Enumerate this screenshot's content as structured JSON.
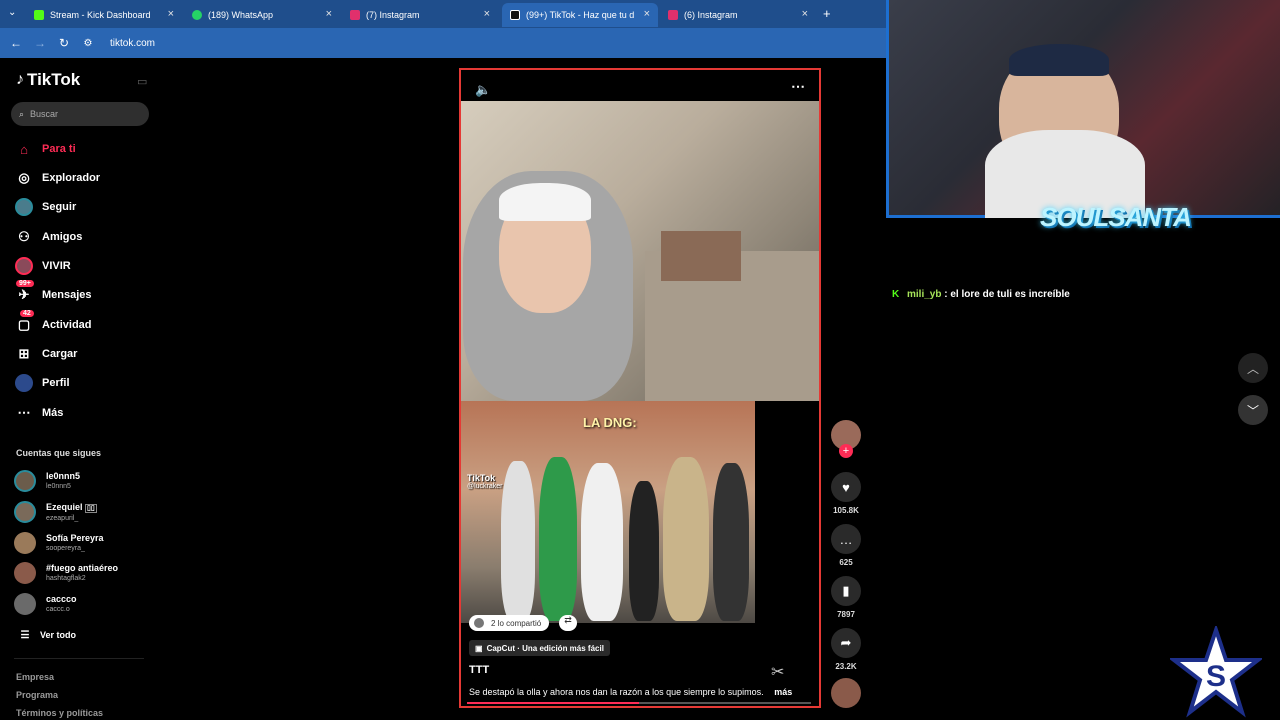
{
  "browser": {
    "tabs": [
      {
        "title": "Stream - Kick Dashboard",
        "icon": "kick-icon",
        "color": "#53fc18"
      },
      {
        "title": "(189) WhatsApp",
        "icon": "whatsapp-icon",
        "color": "#25d366"
      },
      {
        "title": "(7) Instagram",
        "icon": "instagram-icon",
        "color": "#e1306c"
      },
      {
        "title": "(99+) TikTok - Haz que tu d",
        "icon": "tiktok-icon",
        "color": "#000000",
        "active": true
      },
      {
        "title": "(6) Instagram",
        "icon": "instagram-icon",
        "color": "#e1306c"
      }
    ],
    "url": "tiktok.com"
  },
  "sidebar": {
    "logo": "TikTok",
    "search_placeholder": "Buscar",
    "nav": [
      {
        "label": "Para ti",
        "icon": "home-icon",
        "active": true
      },
      {
        "label": "Explorador",
        "icon": "compass-icon"
      },
      {
        "label": "Seguir",
        "icon": "following-icon"
      },
      {
        "label": "Amigos",
        "icon": "friends-icon"
      },
      {
        "label": "VIVIR",
        "icon": "live-icon"
      },
      {
        "label": "Mensajes",
        "icon": "messages-icon",
        "badge": "99+"
      },
      {
        "label": "Actividad",
        "icon": "activity-icon",
        "badge": "42"
      },
      {
        "label": "Cargar",
        "icon": "upload-icon"
      },
      {
        "label": "Perfil",
        "icon": "profile-icon"
      },
      {
        "label": "Más",
        "icon": "more-icon"
      }
    ],
    "following_title": "Cuentas que sigues",
    "following": [
      {
        "name": "le0nnn5",
        "user": "le0nnn5"
      },
      {
        "name": "Ezequiel",
        "user": "ezeapuril_"
      },
      {
        "name": "Sofía Pereyra",
        "user": "soopereyra_"
      },
      {
        "name": "#fuego antiaéreo",
        "user": "hashtagflak2"
      },
      {
        "name": "caccco",
        "user": "caccc.o"
      }
    ],
    "see_all": "Ver todo",
    "footer": [
      "Empresa",
      "Programa",
      "Términos y políticas"
    ]
  },
  "video": {
    "overlay_text": "LA DNG:",
    "tiktok_watermark": "TikTok",
    "watermark_user": "@luckraker",
    "shared_text": "2 lo compartió",
    "capcut_label": "CapCut · Una edición más fácil",
    "title": "TTT",
    "description": "Se destapó la olla y ahora nos dan la razón a los que siempre lo supimos.",
    "more": "más",
    "progress": 0.5
  },
  "actions": {
    "likes": "105.8K",
    "comments": "625",
    "saves": "7897",
    "shares": "23.2K"
  },
  "stream": {
    "name": "SOULSANTA",
    "chat": {
      "user": "mili_yb",
      "message": ": el lore de tuli es increíble"
    }
  }
}
